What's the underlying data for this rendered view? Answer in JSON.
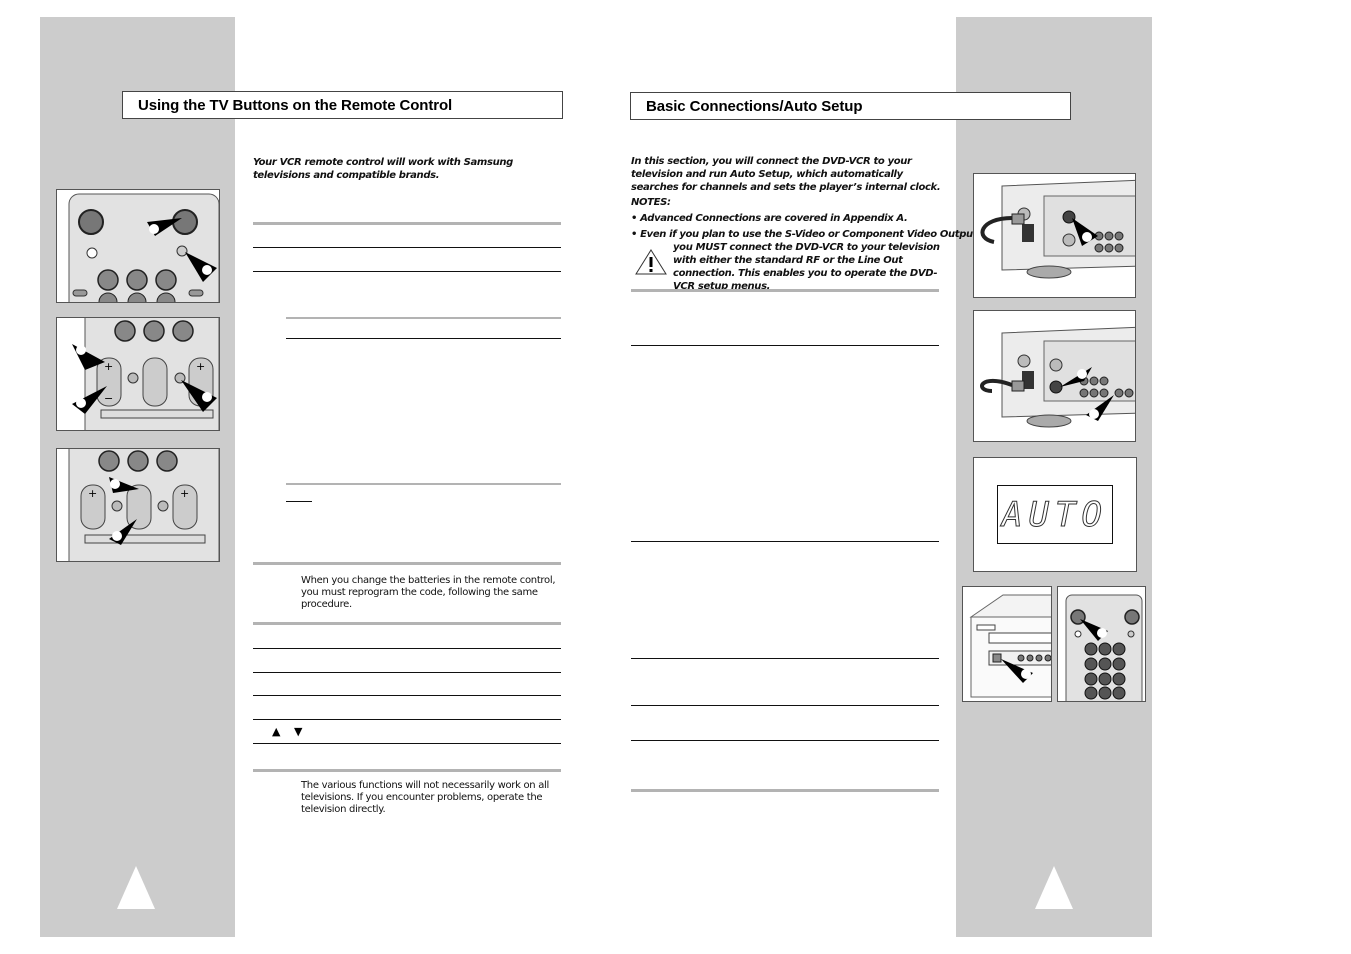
{
  "left_page": {
    "title": "Using the TV Buttons on the Remote Control",
    "intro": "Your VCR remote control will work with Samsung televisions and compatible brands.",
    "battery_note": "When you change the batteries in the remote control, you must reprogram the code, following the same procedure.",
    "arrow_up": "▲",
    "arrow_down": "▼",
    "functions_note": "The various functions will not necessarily work on all televisions. If you encounter problems, operate the television directly.",
    "figures": [
      "remote-top-power-buttons",
      "remote-volume-channel-buttons",
      "remote-channel-up-down-buttons"
    ]
  },
  "right_page": {
    "title": "Basic Connections/Auto Setup",
    "intro": "In this section, you will connect the DVD-VCR to your television and run Auto Setup, which automatically searches for channels and sets the player’s internal clock.",
    "notes_label": "NOTES:",
    "note_1": "• Advanced Connections are covered in Appendix A.",
    "note_2_lead": "• Even if you plan to use the S-Video or Component Video Outputs,",
    "note_2_rest": "you MUST connect the DVD-VCR to your television with either the standard RF or the Line Out connection. This enables you to operate the DVD-VCR setup menus.",
    "display_text": "AUTO",
    "figures": [
      "antenna-in-connection",
      "rf-out-connection",
      "auto-display",
      "front-panel-power",
      "remote-power"
    ]
  },
  "colors": {
    "sidebar_gray": "#cccccc",
    "rule_gray": "#b3b3b3",
    "rule_black": "#111111"
  }
}
